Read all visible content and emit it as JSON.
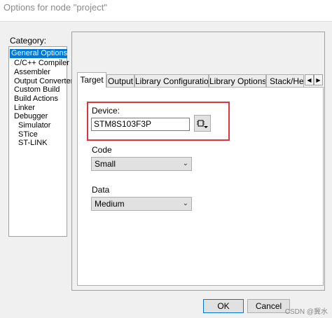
{
  "window": {
    "title": "Options for node \"project\""
  },
  "category": {
    "label": "Category:",
    "items": [
      {
        "label": "General Options",
        "selected": true
      },
      {
        "label": "C/C++ Compiler"
      },
      {
        "label": "Assembler"
      },
      {
        "label": "Output Converter"
      },
      {
        "label": "Custom Build"
      },
      {
        "label": "Build Actions"
      },
      {
        "label": "Linker"
      },
      {
        "label": "Debugger"
      },
      {
        "label": "Simulator"
      },
      {
        "label": "STice"
      },
      {
        "label": "ST-LINK"
      }
    ]
  },
  "tabs": [
    {
      "label": "Target",
      "active": true
    },
    {
      "label": "Output"
    },
    {
      "label": "Library Configuration"
    },
    {
      "label": "Library Options"
    },
    {
      "label": "Stack/Hea"
    }
  ],
  "scroll": {
    "left": "◀",
    "right": "▶"
  },
  "target": {
    "device_label": "Device:",
    "device_value": "STM8S103F3P",
    "code_label": "Code",
    "code_value": "Small",
    "data_label": "Data",
    "data_value": "Medium"
  },
  "buttons": {
    "ok": "OK",
    "cancel": "Cancel"
  },
  "watermark": "CSDN @冀水",
  "colors": {
    "selection": "#0078d7",
    "highlight_box": "#d9363e"
  }
}
